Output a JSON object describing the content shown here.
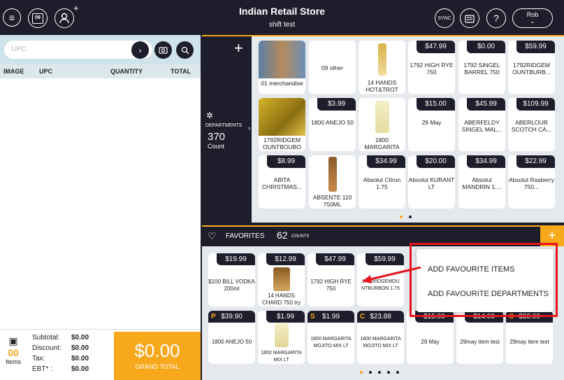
{
  "header": {
    "title": "Indian Retail Store",
    "subtitle": "shift test",
    "calendar_day": "09",
    "sync_label": "SYNC",
    "help_label": "?",
    "user_name": "Rob"
  },
  "cart": {
    "search_placeholder": "UPC",
    "columns": [
      "IMAGE",
      "UPC",
      "QUANTITY",
      "TOTAL"
    ],
    "item_count": "00",
    "items_label": "Items",
    "subtotal_label": "Subtotal:",
    "subtotal": "$0.00",
    "discount_label": "Discount:",
    "discount": "$0.00",
    "tax_label": "Tax:",
    "tax": "$0.00",
    "ebt_label": "EBT* :",
    "ebt": "$0.00",
    "grand_total": "$0.00",
    "grand_total_label": "GRAND TOTAL"
  },
  "departments": {
    "label": "DEPARTMENTS",
    "count": "370",
    "count_label": "Count"
  },
  "products": [
    {
      "name": "01 merchandise",
      "price": ""
    },
    {
      "name": "09 other",
      "price": ""
    },
    {
      "name": "14 HANDS HOT&TROT",
      "price": ""
    },
    {
      "name": "1792 HIGH RYE 750",
      "price": "$47.99"
    },
    {
      "name": "1792 SINGEL BARREL 750",
      "price": "$0.00"
    },
    {
      "name": "1792RIDGEM OUNTBURB...",
      "price": "$59.99"
    },
    {
      "name": "1792RIDGEM OUNTBOUBO",
      "price": ""
    },
    {
      "name": "1800 ANEJO 50",
      "price": "$3.99"
    },
    {
      "name": "1800 MARGARITA",
      "price": ""
    },
    {
      "name": "29 May",
      "price": "$15.00"
    },
    {
      "name": "ABERFELDY SINGEL MAL...",
      "price": "$45.99"
    },
    {
      "name": "ABERLOUR SCOTCH CA...",
      "price": "$109.99"
    },
    {
      "name": "ABITA CHRISTMAS...",
      "price": "$8.99"
    },
    {
      "name": "ABSENTE 110 750ML",
      "price": ""
    },
    {
      "name": "Absolut Citron 1.75",
      "price": "$34.99"
    },
    {
      "name": "Absolut KURANT LT",
      "price": "$20.00"
    },
    {
      "name": "Absolut MANDRIN 1....",
      "price": "$34.99"
    },
    {
      "name": "Absolut Rasberry 750...",
      "price": "$22.99"
    }
  ],
  "favorites": {
    "label": "FAVORITES",
    "count": "62",
    "count_label": "COUNTS",
    "items": [
      {
        "name": "$100 BILL VODKA 200ml",
        "price": "$19.99",
        "tag": ""
      },
      {
        "name": "14 HANDS CHARD 750 try",
        "price": "$12.99",
        "tag": ""
      },
      {
        "name": "1792 HIGH RYE 750",
        "price": "$47.99",
        "tag": ""
      },
      {
        "name": "1792RIDGEMOU NTBURBON 1.75",
        "price": "$59.99",
        "tag": ""
      },
      {
        "name": "1800 ANEJO 50",
        "price": "$39.90",
        "tag": "P"
      },
      {
        "name": "1800 MARGARITA MIX LT",
        "price": "$1.99",
        "tag": ""
      },
      {
        "name": "1800 MARGARITA MOJITO MIX LT",
        "price": "$1.99",
        "tag": "S"
      },
      {
        "name": "1800 MARGARITA MOJITO MIX LT",
        "price": "$23.88",
        "tag": "C"
      },
      {
        "name": "29 May",
        "price": "$15.00",
        "tag": ""
      },
      {
        "name": "29may item test",
        "price": "$14.00",
        "tag": ""
      },
      {
        "name": "29may item test",
        "price": "$30.00",
        "tag": "C"
      }
    ]
  },
  "popup": {
    "add_items": "ADD FAVOURITE ITEMS",
    "add_departments": "ADD FAVOURITE DEPARTMENTS"
  },
  "colors": {
    "dark": "#1e1d2b",
    "accent": "#f7a81b",
    "highlight": "#e8141b"
  }
}
